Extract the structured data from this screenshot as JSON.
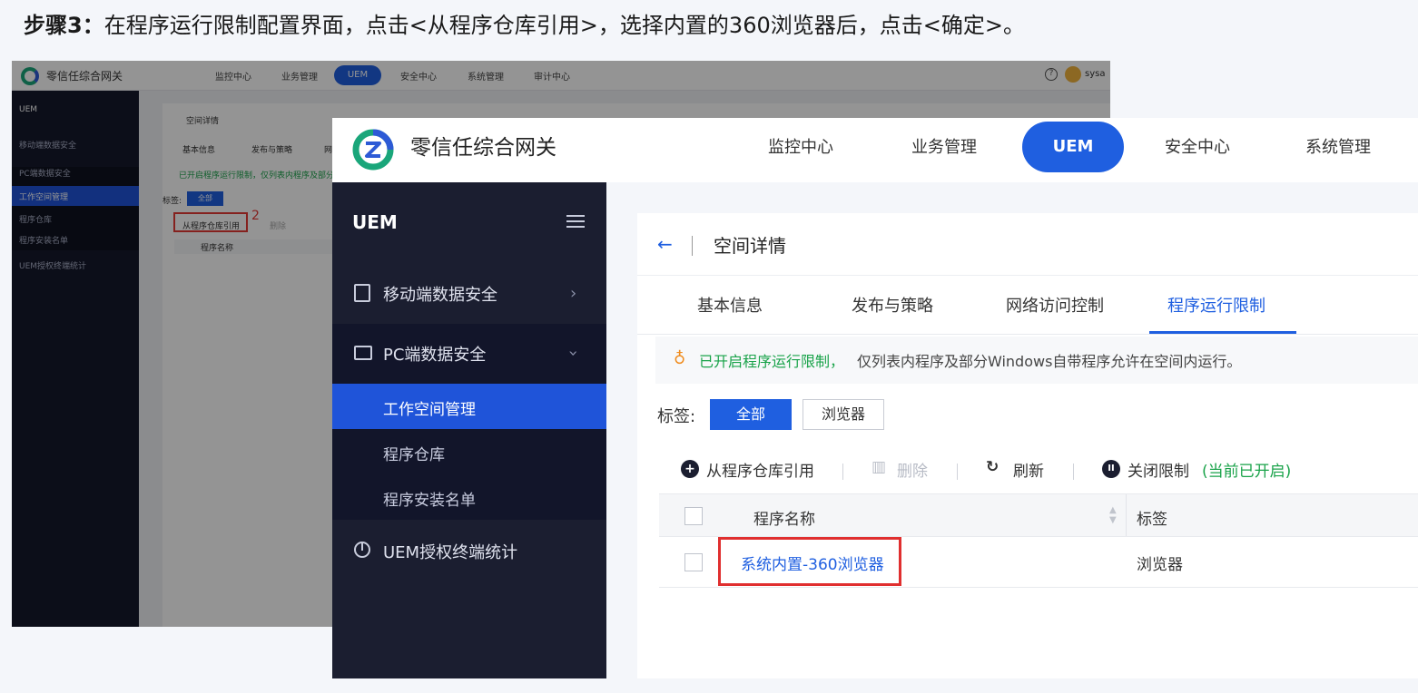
{
  "instruction": {
    "step": "步骤3：",
    "text": "在程序运行限制配置界面，点击<从程序仓库引用>，选择内置的360浏览器后，点击<确定>。"
  },
  "background_screen": {
    "brand": "零信任综合网关",
    "nav": [
      "监控中心",
      "业务管理",
      "UEM",
      "安全中心",
      "系统管理",
      "审计中心"
    ],
    "user": "sysa",
    "sidebar": [
      "UEM",
      "移动端数据安全",
      "PC端数据安全",
      "工作空间管理",
      "程序仓库",
      "程序安装名单",
      "UEM授权终端统计"
    ],
    "page_title": "空间详情",
    "tabs": [
      "基本信息",
      "发布与策略",
      "网"
    ],
    "notice": "已开启程序运行限制，仅列表内程序及部分Wi",
    "tag_label": "标签:",
    "tag_all": "全部",
    "toolbar_ref": "从程序仓库引用",
    "toolbar_del": "删除",
    "col_name": "程序名称",
    "callout_number": "2"
  },
  "app": {
    "brand": "零信任综合网关",
    "nav": {
      "monitor": "监控中心",
      "business": "业务管理",
      "uem": "UEM",
      "security": "安全中心",
      "system": "系统管理"
    }
  },
  "sidebar": {
    "header": "UEM",
    "mobile": "移动端数据安全",
    "pc": "PC端数据安全",
    "workspace": "工作空间管理",
    "repo": "程序仓库",
    "install_list": "程序安装名单",
    "stats": "UEM授权终端统计"
  },
  "main": {
    "back": "←",
    "title": "空间详情",
    "tabs": {
      "basic": "基本信息",
      "publish": "发布与策略",
      "network": "网络访问控制",
      "program": "程序运行限制"
    },
    "notice_green": "已开启程序运行限制，",
    "notice_rest": "仅列表内程序及部分Windows自带程序允许在空间内运行。",
    "tag_label": "标签:",
    "tag_all": "全部",
    "tag_browser": "浏览器",
    "toolbar": {
      "ref": "从程序仓库引用",
      "delete": "删除",
      "refresh": "刷新",
      "close_limit": "关闭限制",
      "status": "(当前已开启)"
    },
    "table": {
      "col_name": "程序名称",
      "col_tag": "标签",
      "rows": [
        {
          "name": "系统内置-360浏览器",
          "tag": "浏览器"
        }
      ]
    }
  }
}
